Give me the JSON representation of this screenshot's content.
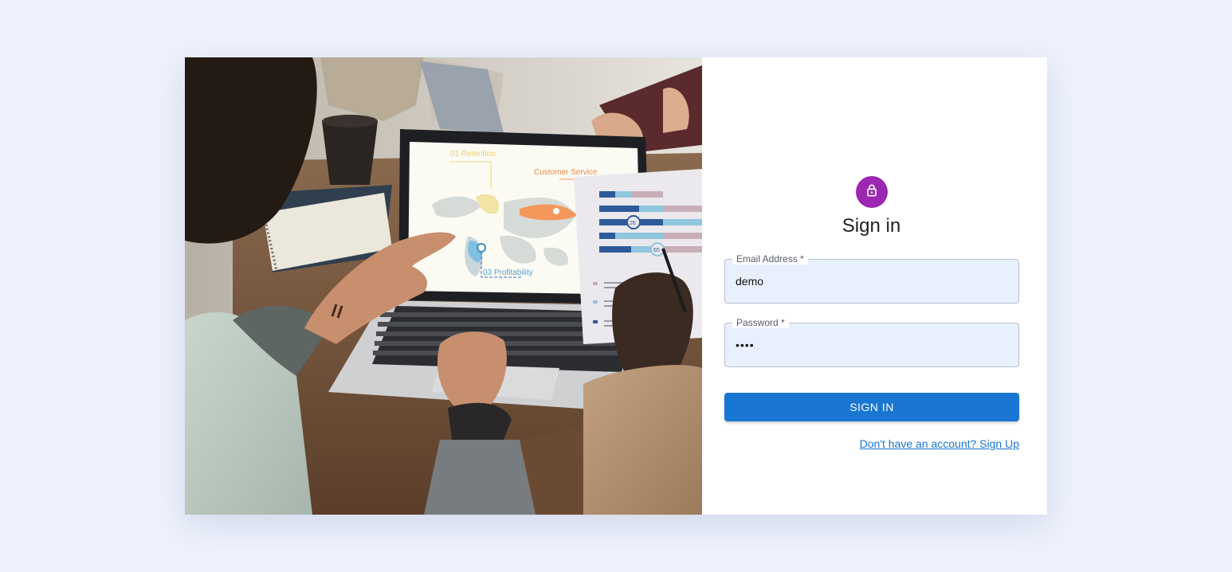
{
  "form": {
    "title": "Sign in",
    "email_label": "Email Address *",
    "email_value": "demo",
    "password_label": "Password *",
    "password_value": "demo",
    "submit_label": "SIGN IN",
    "signup_link": "Don't have an account? Sign Up"
  },
  "hero": {
    "screen_labels": [
      "01 Retention",
      "Customer Service",
      "03 Profitability"
    ],
    "report_markers": [
      "26",
      "65"
    ]
  },
  "icons": {
    "avatar": "lock-icon"
  },
  "colors": {
    "page_background": "#eef2fd",
    "avatar": "#9c27b0",
    "primary": "#1976d2",
    "input_fill": "#e8f0fe"
  }
}
